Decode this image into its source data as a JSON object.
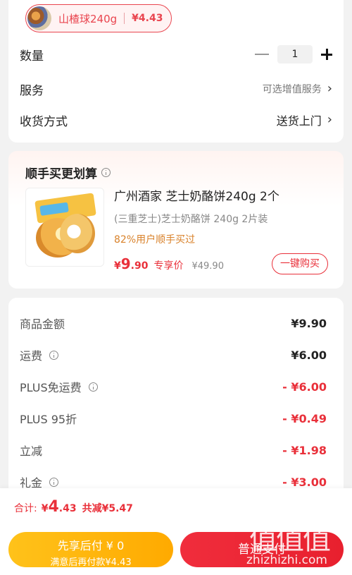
{
  "variant": {
    "name": "山楂球240g",
    "price": "¥4.43"
  },
  "rows": {
    "quantity": {
      "label": "数量",
      "value": "1"
    },
    "service": {
      "label": "服务",
      "value": "可选增值服务"
    },
    "delivery": {
      "label": "收货方式",
      "value": "送货上门"
    }
  },
  "bundle": {
    "title": "顺手买更划算",
    "product_name": "广州酒家 芝士奶酪饼240g 2个",
    "product_sub": "(三重芝士)芝士奶酪饼 240g 2片装",
    "bought": "82%用户顺手买过",
    "price_symbol": "¥",
    "price_int": "9",
    "price_dec": ".90",
    "price_tag": "专享价",
    "original_price": "¥49.90",
    "buy_label": "一键购买"
  },
  "price_lines": [
    {
      "label": "商品金额",
      "value": "¥9.90",
      "info": false,
      "red": false
    },
    {
      "label": "运费",
      "value": "¥6.00",
      "info": true,
      "red": false
    },
    {
      "label": "PLUS免运费",
      "value": "- ¥6.00",
      "info": true,
      "red": true
    },
    {
      "label": "PLUS 95折",
      "value": "- ¥0.49",
      "info": false,
      "red": true
    },
    {
      "label": "立减",
      "value": "- ¥1.98",
      "info": false,
      "red": true
    },
    {
      "label": "礼金",
      "value": "- ¥3.00",
      "info": true,
      "red": true
    }
  ],
  "bottom": {
    "total_label": "合计:",
    "total_symbol": "¥",
    "total_int": "4",
    "total_dec": ".43",
    "total_save": "共减¥5.47",
    "later_line1": "先享后付 ¥ 0",
    "later_line2": "满意后再付款¥4.43",
    "pay_label": "普通支付"
  },
  "watermark": {
    "logo": "值值值",
    "text": "zhizhizhi.com"
  },
  "colors": {
    "accent_red": "#e9303a",
    "later_yellow": "#ffb80d"
  }
}
